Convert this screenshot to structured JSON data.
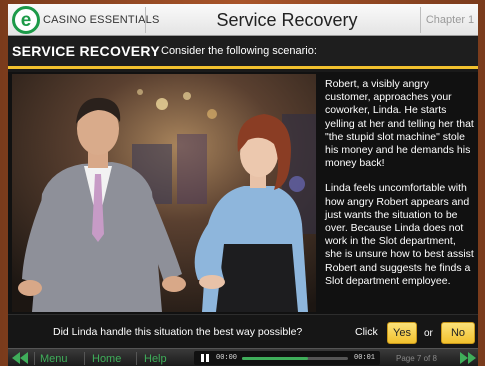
{
  "header": {
    "logo_letter": "e",
    "brand": "CASINO ESSENTIALS",
    "course_title": "Service Recovery",
    "chapter": "Chapter 1"
  },
  "section": {
    "title": "SERVICE RECOVERY",
    "subtitle": "Consider the following scenario:"
  },
  "story": {
    "paragraph1": "Robert, a visibly angry customer, approaches your coworker, Linda. He starts yelling at her and telling her that \"the stupid slot machine\" stole his money and he demands his money back!",
    "paragraph2": "Linda feels uncomfortable with how angry Robert appears and just wants the situation to be over. Because Linda does not work in the Slot department, she is unsure how to best assist Robert and suggests he finds a Slot department employee."
  },
  "question": {
    "text": "Did Linda handle this situation the best way possible?",
    "click_label": "Click",
    "yes_label": "Yes",
    "or_label": "or",
    "no_label": "No"
  },
  "nav": {
    "back_icon": "double-left-arrow-icon",
    "menu_label": "Menu",
    "home_label": "Home",
    "help_label": "Help",
    "time_start": "00:00",
    "time_end": "00:01",
    "progress": 0.62,
    "page_label": "Page 7 of 8",
    "forward_icon": "double-right-arrow-icon"
  },
  "colors": {
    "accent_yellow": "#f2c12e",
    "brand_green": "#1c9a48",
    "nav_green": "#3fae5a"
  }
}
